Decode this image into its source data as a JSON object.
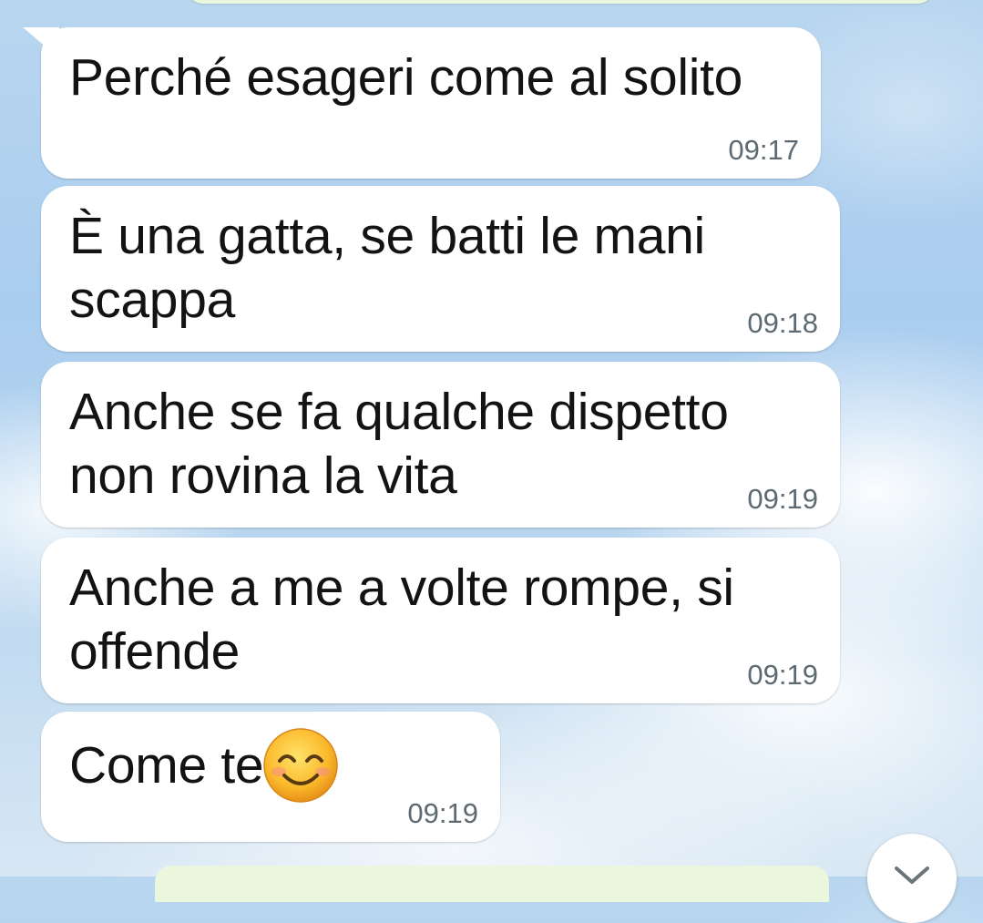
{
  "messages": [
    {
      "text": "Perché esageri come al solito",
      "time": "09:17"
    },
    {
      "text": "È una gatta, se batti le mani\nscappa",
      "time": "09:18"
    },
    {
      "text": "Anche se fa qualche dispetto\nnon rovina la vita",
      "time": "09:19"
    },
    {
      "text": "Anche a me a volte rompe, si\noffende",
      "time": "09:19"
    },
    {
      "text": "Come te",
      "time": "09:19",
      "emoji": "smiling-face-with-smiling-eyes"
    }
  ],
  "colors": {
    "incoming_bubble": "#ffffff",
    "outgoing_bubble": "#eaf7dd",
    "message_text": "#131313",
    "timestamp_text": "#5e6a71"
  },
  "icons": {
    "scroll_down": "chevron-down-icon"
  }
}
